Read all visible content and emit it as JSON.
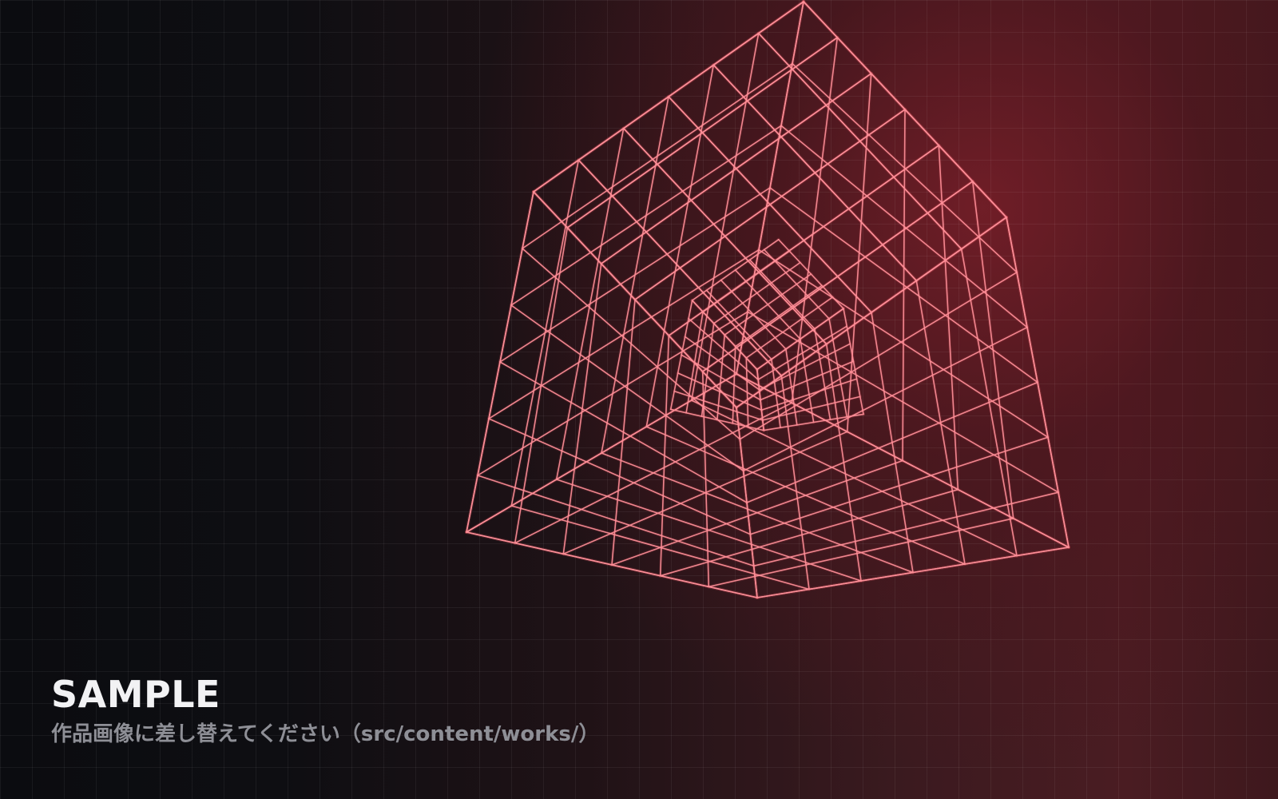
{
  "placeholder": {
    "title": "SAMPLE",
    "subtitle": "作品画像に差し替えてください（src/content/works/）"
  },
  "colors": {
    "wireframe": "#ff8f98",
    "background_dark": "#0b0c10",
    "background_red": "#4a1c22",
    "title": "#f2f2f4",
    "subtitle": "#8e8f96"
  }
}
